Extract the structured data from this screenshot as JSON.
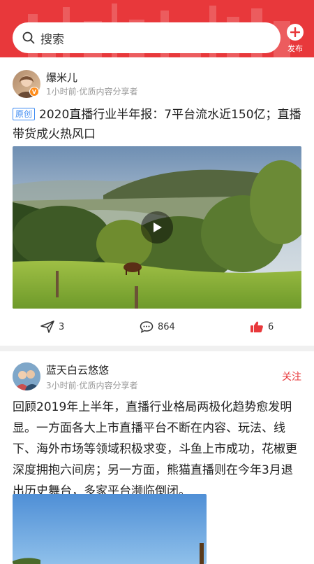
{
  "header": {
    "search_placeholder": "搜索",
    "publish_label": "发布",
    "accent_color": "#e8383b"
  },
  "feed": {
    "post1": {
      "username": "爆米儿",
      "meta": "1小时前·优质内容分享者",
      "verified": true,
      "tag": "原创",
      "title": "2020直播行业半年报：7平台流水近150亿；直播带货成火热风口",
      "media": "video",
      "share_count": "3",
      "comment_count": "864",
      "like_count": "6"
    },
    "post2": {
      "username": "蓝天白云悠悠",
      "meta": "3小时前·优质内容分享者",
      "follow_label": "关注",
      "text": "回顾2019年上半年，直播行业格局两极化趋势愈发明显。一方面各大上市直播平台不断在内容、玩法、线下、海外市场等领域积极求变，斗鱼上市成功，花椒更深度拥抱六间房；另一方面，熊猫直播则在今年3月退出历史舞台，多家平台濒临倒闭。",
      "media": "photo"
    }
  },
  "icons": {
    "search": "search-icon",
    "publish": "plus-icon",
    "share": "send-icon",
    "comment": "comment-icon",
    "like": "thumbs-up-icon",
    "play": "play-icon"
  }
}
